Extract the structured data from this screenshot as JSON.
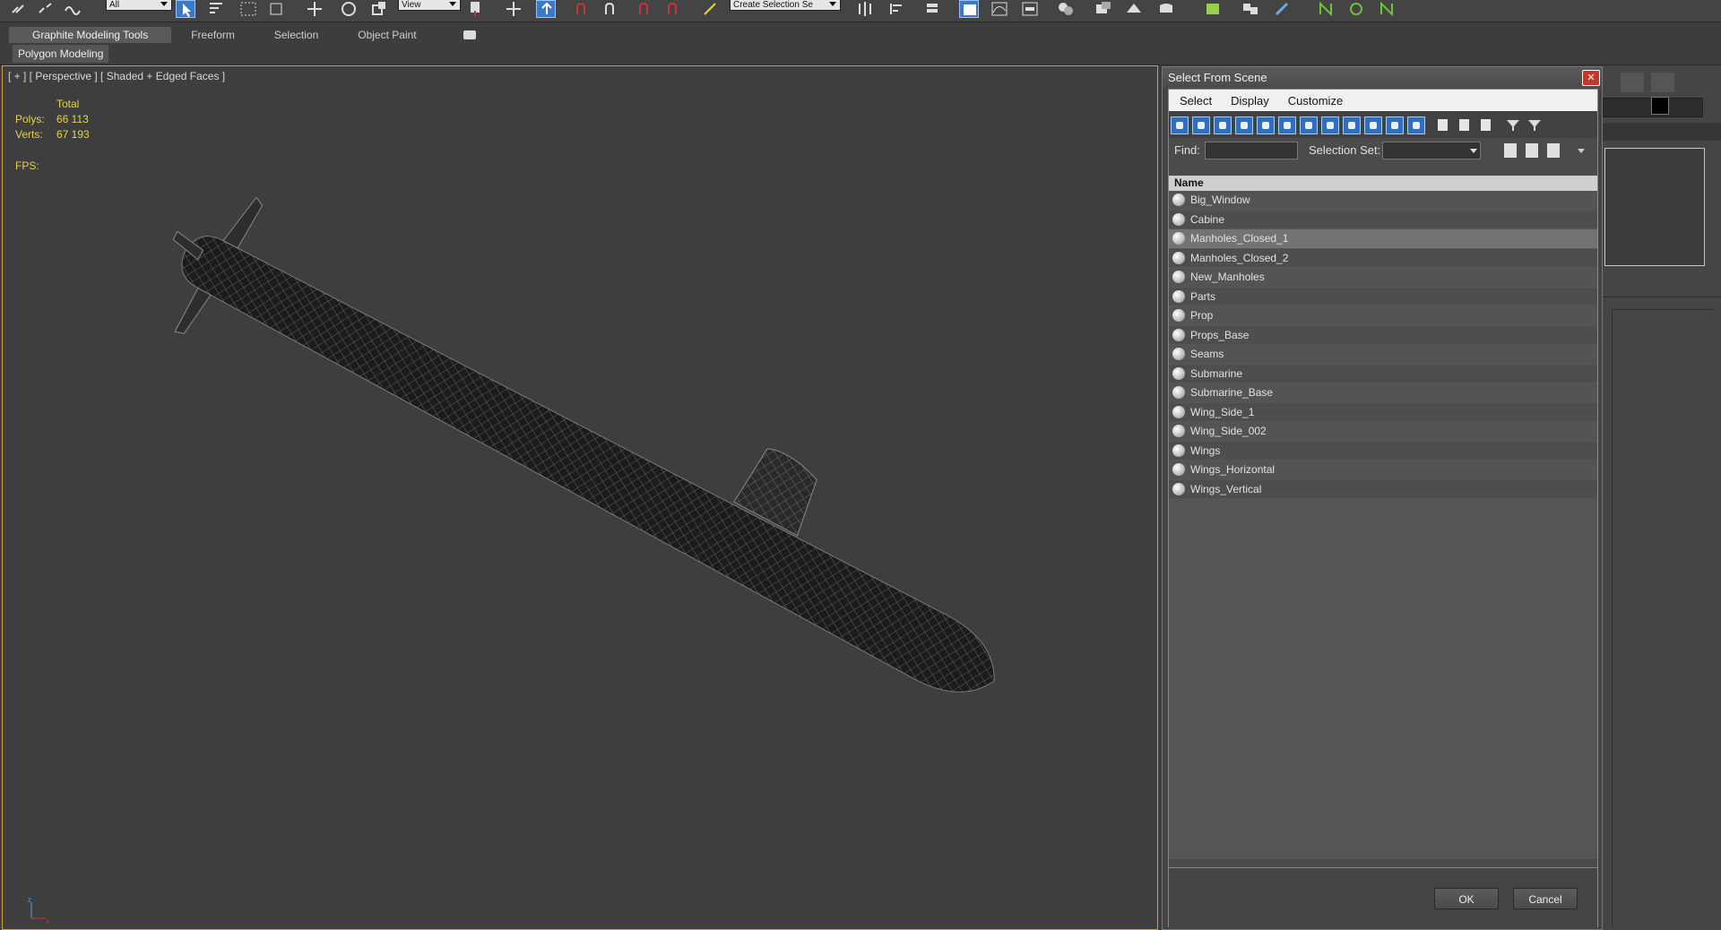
{
  "toolbar": {
    "layer_combo": "All",
    "view_combo": "View",
    "selection_set_combo": "Create Selection Se"
  },
  "ribbon": {
    "tabs": [
      "Graphite Modeling Tools",
      "Freeform",
      "Selection",
      "Object Paint"
    ],
    "sub_label": "Polygon Modeling"
  },
  "viewport": {
    "label": "[ + ] [ Perspective ] [ Shaded + Edged Faces ]",
    "stats": {
      "total_label": "Total",
      "polys_label": "Polys:",
      "polys_value": "66 113",
      "verts_label": "Verts:",
      "verts_value": "67 193",
      "fps_label": "FPS:"
    },
    "axis": {
      "x": "x",
      "y": "y",
      "z": "z"
    }
  },
  "dialog": {
    "title": "Select From Scene",
    "close_glyph": "✕",
    "menu": [
      "Select",
      "Display",
      "Customize"
    ],
    "find_label": "Find:",
    "find_value": "",
    "selection_set_label": "Selection Set:",
    "column_header": "Name",
    "items": [
      "Big_Window",
      "Cabine",
      "Manholes_Closed_1",
      "Manholes_Closed_2",
      "New_Manholes",
      "Parts",
      "Prop",
      "Props_Base",
      "Seams",
      "Submarine",
      "Submarine_Base",
      "Wing_Side_1",
      "Wing_Side_002",
      "Wings",
      "Wings_Horizontal",
      "Wings_Vertical"
    ],
    "selected_index": 2,
    "ok_label": "OK",
    "cancel_label": "Cancel"
  },
  "colors": {
    "stats": "#e6d34a",
    "viewport_border": "#c8a23a",
    "accent_blue": "#2f6fc0"
  }
}
